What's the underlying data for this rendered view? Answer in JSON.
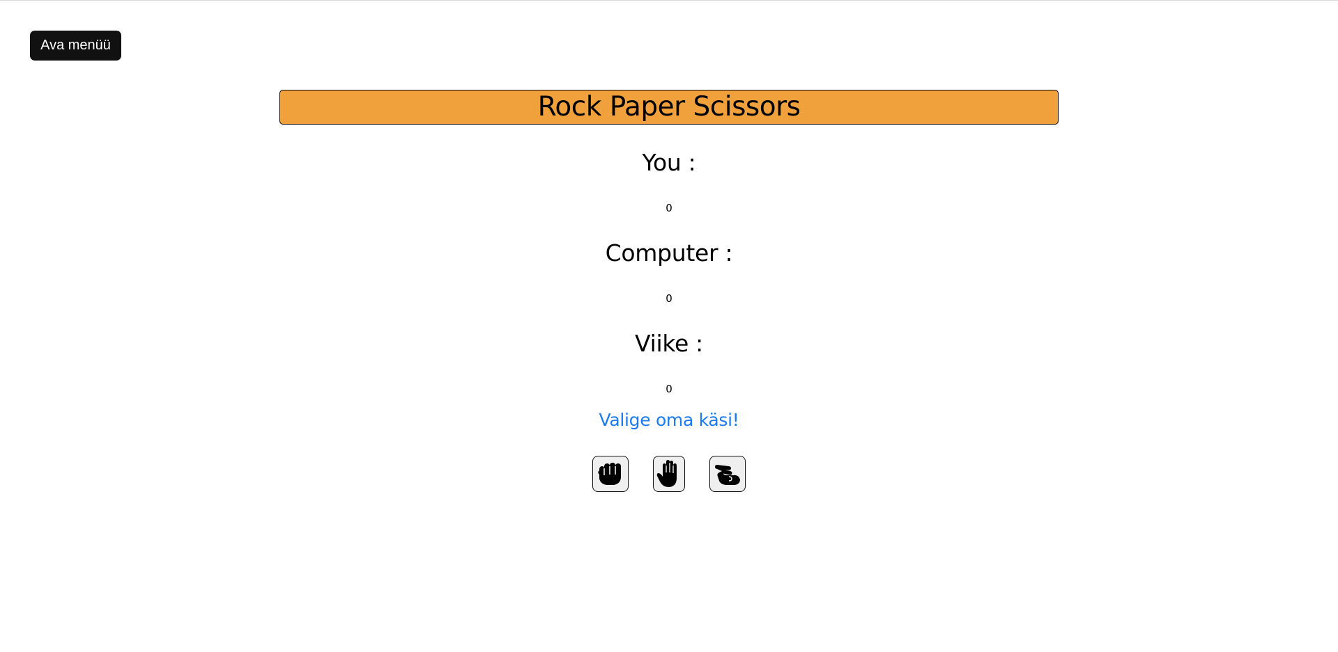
{
  "menu": {
    "open_label": "Ava menüü"
  },
  "game": {
    "title": "Rock Paper Scissors",
    "scores": {
      "you_label": "You :",
      "you_value": "0",
      "computer_label": "Computer :",
      "computer_value": "0",
      "draw_label": "Viike :",
      "draw_value": "0"
    },
    "prompt": "Valige oma käsi!",
    "choices": [
      {
        "name": "rock",
        "icon": "fist-icon"
      },
      {
        "name": "paper",
        "icon": "open-hand-icon"
      },
      {
        "name": "scissors",
        "icon": "two-fingers-icon"
      }
    ]
  },
  "colors": {
    "title_bar": "#f0a13c",
    "prompt": "#1a7bf2",
    "menu_button": "#111111",
    "hand_button_bg": "#efefef"
  }
}
